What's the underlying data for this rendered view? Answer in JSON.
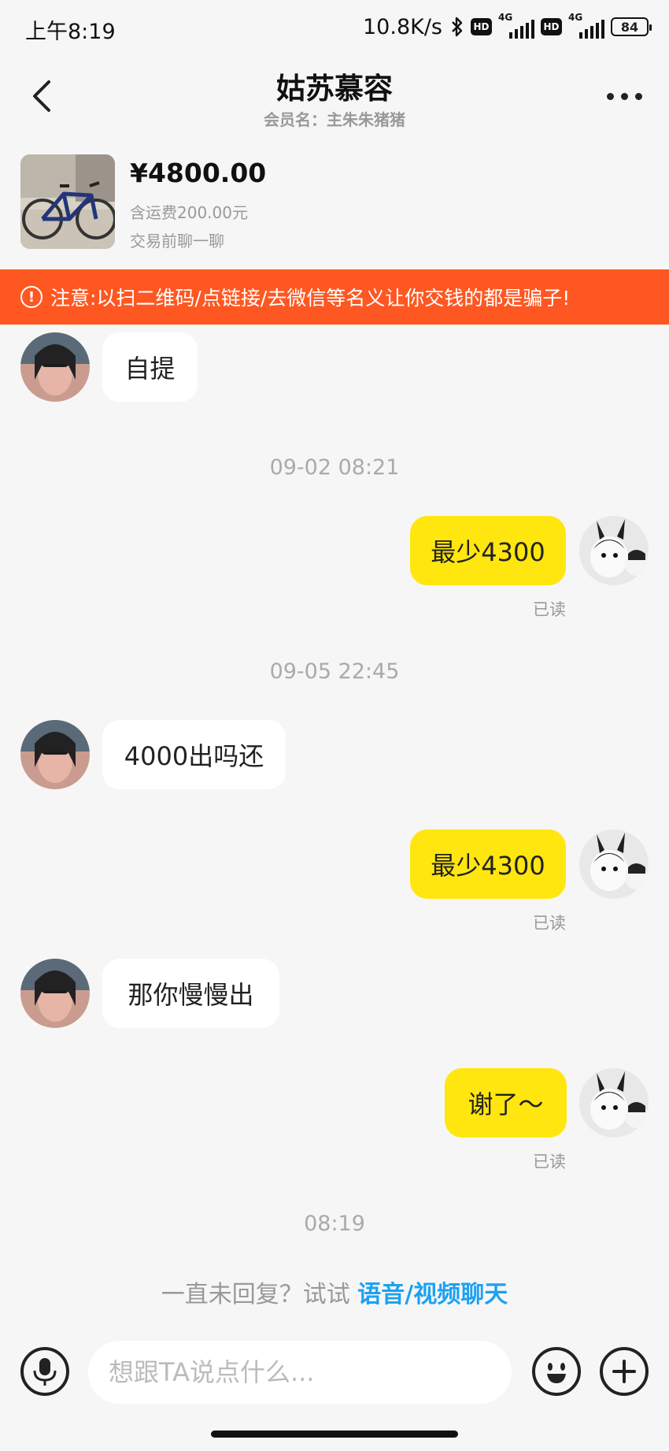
{
  "status_bar": {
    "time": "上午8:19",
    "speed": "10.8K/s",
    "hd1": "HD",
    "sig1": "4G",
    "hd2": "HD",
    "sig2": "4G",
    "battery": "84"
  },
  "header": {
    "title": "姑苏慕容",
    "subtitle": "会员名：主朱朱猪猪",
    "icons": [
      "back-arrow",
      "more-dots"
    ]
  },
  "product": {
    "price": "¥4800.00",
    "shipping": "含运费200.00元",
    "note": "交易前聊一聊"
  },
  "warning": {
    "icon": "!",
    "text": "注意:以扫二维码/点链接/去微信等名义让你交钱的都是骗子!"
  },
  "messages": [
    {
      "from": "them",
      "text": "自提"
    },
    {
      "timestamp": "09-02 08:21"
    },
    {
      "from": "me",
      "text": "最少4300",
      "status": "已读"
    },
    {
      "timestamp": "09-05 22:45"
    },
    {
      "from": "them",
      "text": "4000出吗还"
    },
    {
      "from": "me",
      "text": "最少4300",
      "status": "已读"
    },
    {
      "from": "them",
      "text": "那你慢慢出"
    },
    {
      "from": "me",
      "text": "谢了～",
      "status": "已读"
    },
    {
      "timestamp": "08:19"
    }
  ],
  "hint": {
    "prefix": "一直未回复？试试 ",
    "link": "语音/视频聊天"
  },
  "input_bar": {
    "placeholder": "想跟TA说点什么...",
    "icons": [
      "mic-icon",
      "emoji-icon",
      "plus-icon"
    ]
  },
  "colors": {
    "accent": "#ffe60f",
    "warning": "#ff5722",
    "link": "#1da1f2"
  }
}
